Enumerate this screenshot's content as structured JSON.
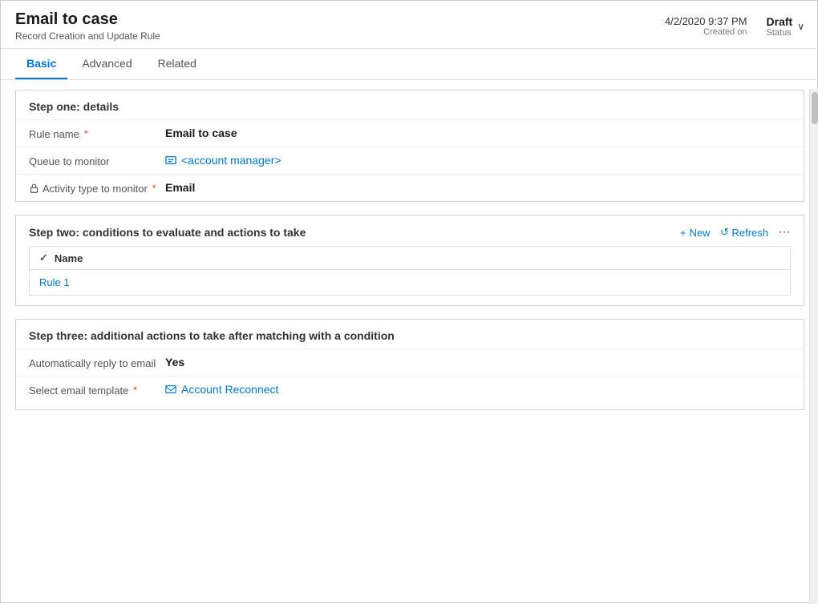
{
  "header": {
    "title": "Email to case",
    "subtitle": "Record Creation and Update Rule",
    "date": "4/2/2020 9:37 PM",
    "date_label": "Created on",
    "status": "Draft",
    "status_label": "Status"
  },
  "tabs": [
    {
      "id": "basic",
      "label": "Basic",
      "active": true
    },
    {
      "id": "advanced",
      "label": "Advanced",
      "active": false
    },
    {
      "id": "related",
      "label": "Related",
      "active": false
    }
  ],
  "step_one": {
    "title": "Step one: details",
    "fields": [
      {
        "label": "Rule name",
        "required": true,
        "value": "Email to case",
        "type": "text"
      },
      {
        "label": "Queue to monitor",
        "required": false,
        "value": "<account manager>",
        "type": "link"
      },
      {
        "label": "Activity type to monitor",
        "required": true,
        "value": "Email",
        "type": "bold",
        "has_lock": true
      }
    ]
  },
  "step_two": {
    "title": "Step two: conditions to evaluate and actions to take",
    "actions": {
      "new_label": "New",
      "refresh_label": "Refresh"
    },
    "table": {
      "column_header": "Name",
      "rows": [
        {
          "name": "Rule 1"
        }
      ]
    }
  },
  "step_three": {
    "title": "Step three: additional actions to take after matching with a condition",
    "fields": [
      {
        "label": "Automatically reply to email",
        "required": false,
        "value": "Yes",
        "type": "bold"
      },
      {
        "label": "Select email template",
        "required": true,
        "value": "Account Reconnect",
        "type": "link"
      }
    ]
  },
  "icons": {
    "plus": "+",
    "refresh": "↺",
    "dots": "···",
    "chevron_down": "∨",
    "check": "✓"
  }
}
